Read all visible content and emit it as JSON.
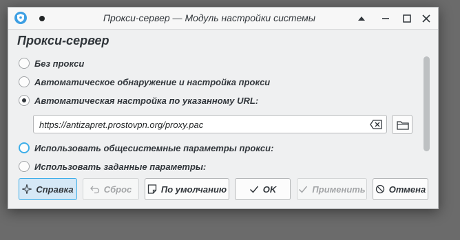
{
  "window": {
    "title": "Прокси-сервер — Модуль настройки системы"
  },
  "page": {
    "heading": "Прокси-сервер"
  },
  "options": [
    {
      "label": "Без прокси",
      "checked": false
    },
    {
      "label": "Автоматическое обнаружение и настройка прокси",
      "checked": false
    },
    {
      "label": "Автоматическая настройка по указанному URL:",
      "checked": true
    },
    {
      "label": "Использовать общесистемные параметры прокси:",
      "checked": false
    },
    {
      "label": "Использовать заданные параметры:",
      "checked": false
    }
  ],
  "url_field": {
    "value": "https://antizapret.prostovpn.org/proxy.pac"
  },
  "buttons": {
    "help": "Справка",
    "reset": "Сброс",
    "defaults": "По умолчанию",
    "ok": "OK",
    "apply": "Применить",
    "cancel": "Отмена"
  },
  "colors": {
    "accent": "#3daee9",
    "window_bg": "#eff0f1",
    "text": "#31363b",
    "disabled_text": "#a3a5a7"
  }
}
